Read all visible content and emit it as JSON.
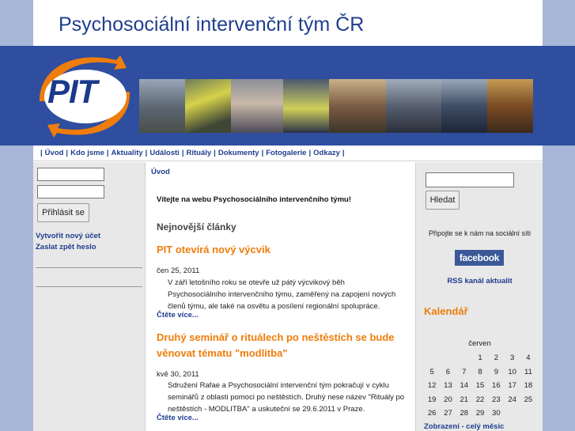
{
  "site_title": "Psychosociální intervenční tým ČR",
  "logo_text": "PIT",
  "nav": {
    "items": [
      "Úvod",
      "Kdo jsme",
      "Aktuality",
      "Události",
      "Rituály",
      "Dokumenty",
      "Fotogalerie",
      "Odkazy"
    ]
  },
  "login": {
    "username_value": "",
    "password_value": "",
    "button_label": "Přihlásit se",
    "create_account": "Vytvořit nový účet",
    "send_password": "Zaslat zpět heslo"
  },
  "main": {
    "breadcrumb": "Úvod",
    "welcome": "Vítejte na webu Psychosociálního intervenčního týmu!",
    "latest_heading": "Nejnovější články",
    "articles": [
      {
        "title": "PIT otevírá nový výcvik",
        "date": "čen 25, 2011",
        "body": "V září letošního roku se otevře už pátý výcvikový běh Psychosociálního intervenčního týmu, zaměřený na zapojení nových členů týmu, ale také na osvětu a posílení regionální spolupráce.",
        "more": "Čtěte více..."
      },
      {
        "title": "Druhý seminář o rituálech po neštěstích se bude věnovat tématu \"modlitba\"",
        "date": "kvě 30, 2011",
        "body": "Sdružení Rafae a Psychosociální intervenční tým pokračují v cyklu seminářů z oblasti pomoci po neštěstích. Druhý nese název \"Rituály po neštěstích - MODLITBA\" a uskuteční se 29.6.2011 v Praze.",
        "more": "Čtěte více..."
      }
    ]
  },
  "sidebar": {
    "search_value": "",
    "search_button": "Hledat",
    "social_text": "Připojte se k nám na sociální síti",
    "facebook_label": "facebook",
    "rss_link": "RSS kanál aktualit",
    "calendar_heading": "Kalendář",
    "calendar_month": "červen",
    "calendar_weeks": [
      [
        "",
        "",
        "",
        "1",
        "2",
        "3",
        "4"
      ],
      [
        "5",
        "6",
        "7",
        "8",
        "9",
        "10",
        "11"
      ],
      [
        "12",
        "13",
        "14",
        "15",
        "16",
        "17",
        "18"
      ],
      [
        "19",
        "20",
        "21",
        "22",
        "23",
        "24",
        "25"
      ],
      [
        "26",
        "27",
        "28",
        "29",
        "30",
        "",
        ""
      ]
    ],
    "calendar_link": "Zobrazení - celý měsíc"
  },
  "colors": {
    "brand_blue": "#1f3e8f",
    "accent_orange": "#ef7d0b",
    "facebook_blue": "#3b5998"
  }
}
